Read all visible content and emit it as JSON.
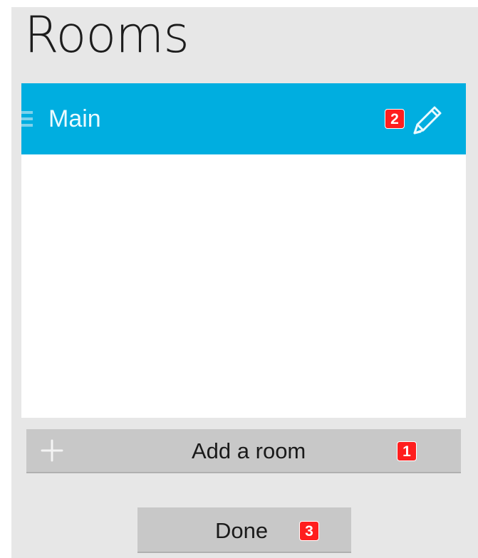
{
  "page": {
    "title": "Rooms"
  },
  "rooms": {
    "items": [
      {
        "name": "Main",
        "badge": "2"
      }
    ],
    "selected_color": "#00aee0"
  },
  "actions": {
    "add_room_label": "Add a room",
    "add_room_badge": "1",
    "done_label": "Done",
    "done_badge": "3"
  },
  "icons": {
    "drag": "drag-handle-icon",
    "edit": "pencil-icon",
    "add": "plus-icon"
  },
  "colors": {
    "background": "#e7e7e7",
    "accent": "#00aee0",
    "badge": "#ff1e1e",
    "button": "#c8c8c8"
  }
}
